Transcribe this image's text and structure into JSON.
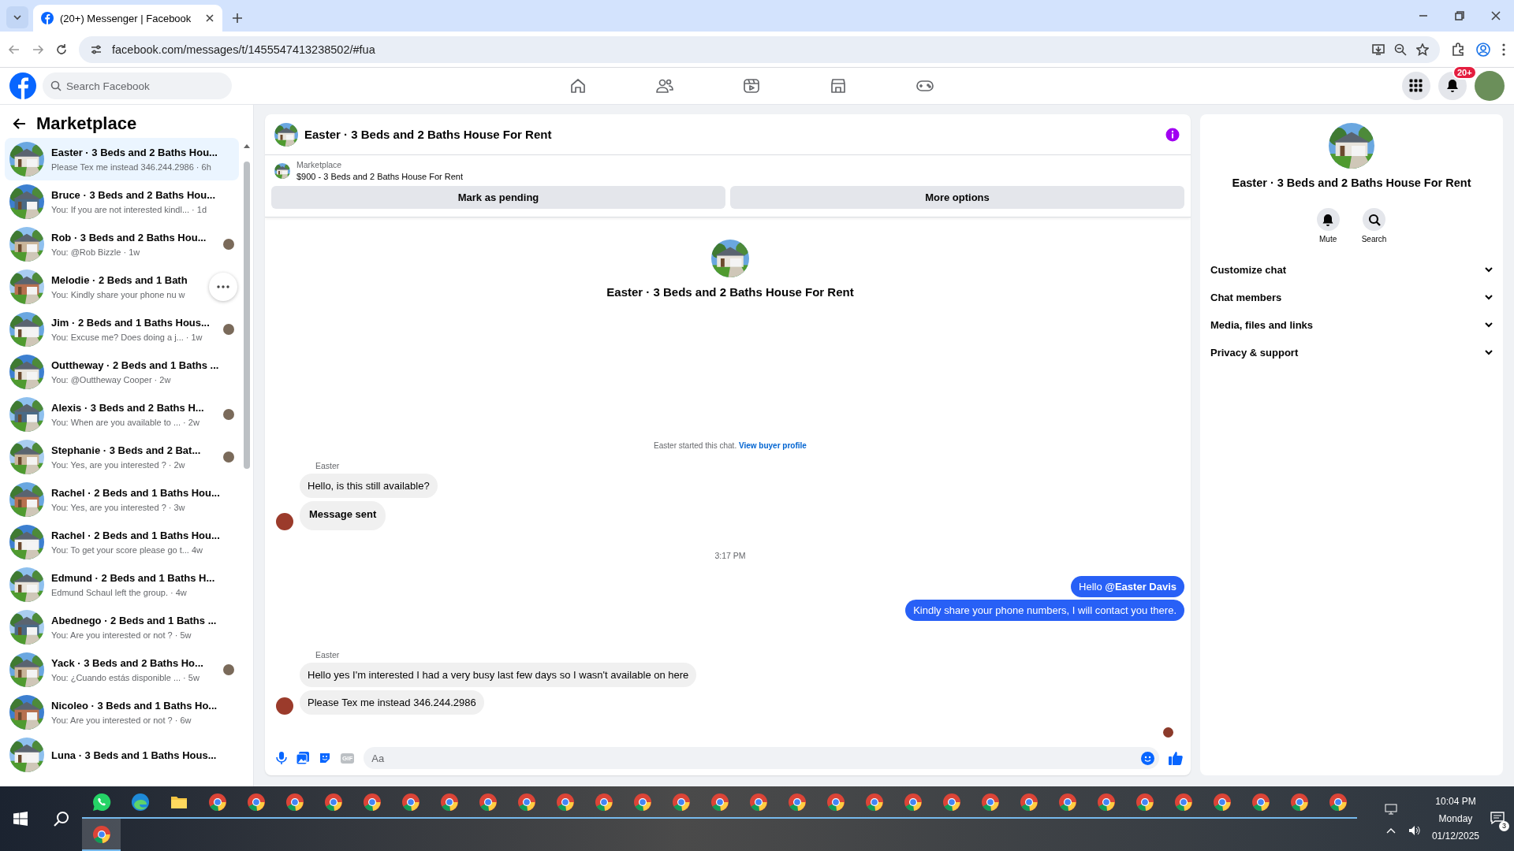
{
  "browser": {
    "tab_title": "(20+) Messenger | Facebook",
    "url": "facebook.com/messages/t/1455547413238502/#fua"
  },
  "topbar": {
    "search_placeholder": "Search Facebook",
    "nav": [
      {
        "kind": "home"
      },
      {
        "kind": "friends"
      },
      {
        "kind": "video"
      },
      {
        "kind": "marketplace"
      },
      {
        "kind": "gaming"
      }
    ],
    "notification_badge": "20+"
  },
  "sidebar": {
    "title": "Marketplace",
    "conversations": [
      {
        "name": "Easter · 3 Beds and 2 Baths Hou...",
        "preview": "Please Tex me instead 346.244.2986",
        "time": "· 6h",
        "selected": true,
        "seen": false,
        "more_button": false
      },
      {
        "name": "Bruce · 3 Beds and 2 Baths Hou...",
        "preview": "You: If you are not interested kindl...",
        "time": "· 1d",
        "selected": false,
        "seen": false,
        "more_button": false
      },
      {
        "name": "Rob · 3 Beds and 2 Baths Hou...",
        "preview": "You: @Rob Bizzle",
        "time": "· 1w",
        "selected": false,
        "seen": true,
        "more_button": false
      },
      {
        "name": "Melodie · 2 Beds and 1 Bath",
        "preview": "You: Kindly share your phone nu",
        "time": "w",
        "selected": false,
        "seen": false,
        "more_button": true
      },
      {
        "name": "Jim · 2 Beds and 1 Baths Hous...",
        "preview": "You: Excuse me? Does doing a j...",
        "time": "· 1w",
        "selected": false,
        "seen": true,
        "more_button": false
      },
      {
        "name": "Outtheway · 2 Beds and 1 Baths ...",
        "preview": "You: @Outtheway Cooper",
        "time": "· 2w",
        "selected": false,
        "seen": false,
        "more_button": false
      },
      {
        "name": "Alexis · 3 Beds and 2 Baths H...",
        "preview": "You: When are you available to ...",
        "time": "· 2w",
        "selected": false,
        "seen": true,
        "more_button": false
      },
      {
        "name": "Stephanie · 3 Beds and 2 Bat...",
        "preview": "You: Yes, are you interested ?",
        "time": "· 2w",
        "selected": false,
        "seen": true,
        "more_button": false
      },
      {
        "name": "Rachel · 2 Beds and 1 Baths Hou...",
        "preview": "You: Yes, are you interested ?",
        "time": "· 3w",
        "selected": false,
        "seen": false,
        "more_button": false
      },
      {
        "name": "Rachel · 2 Beds and 1 Baths Hou...",
        "preview": "You: To get your score please go t...",
        "time": "4w",
        "selected": false,
        "seen": false,
        "more_button": false
      },
      {
        "name": "Edmund · 2 Beds and 1 Baths H...",
        "preview": "Edmund Schaul left the group.",
        "time": "· 4w",
        "selected": false,
        "seen": false,
        "more_button": false
      },
      {
        "name": "Abednego · 2 Beds and 1 Baths ...",
        "preview": "You: Are you interested or not ?",
        "time": "· 5w",
        "selected": false,
        "seen": false,
        "more_button": false
      },
      {
        "name": "Yack · 3 Beds and 2 Baths Ho...",
        "preview": "You: ¿Cuando estás disponible ...",
        "time": "· 5w",
        "selected": false,
        "seen": true,
        "more_button": false
      },
      {
        "name": "Nicoleo · 3 Beds and 1 Baths Ho...",
        "preview": "You: Are you interested or not ?",
        "time": "· 6w",
        "selected": false,
        "seen": false,
        "more_button": false
      },
      {
        "name": "Luna · 3 Beds and 1 Baths Hous...",
        "selected": false,
        "seen": false,
        "more_button": false
      }
    ]
  },
  "chat": {
    "title": "Easter · 3 Beds and 2 Baths House For Rent",
    "listing": {
      "label": "Marketplace",
      "text": "$900 - 3 Beds and 2 Baths House For Rent"
    },
    "actions": [
      "Mark as pending",
      "More options"
    ],
    "intro_title": "Easter · 3 Beds and 2 Baths House For Rent",
    "started": {
      "text": "Easter started this chat.",
      "link": "View buyer profile"
    },
    "thread": [
      {
        "kind": "sender",
        "text": "Easter"
      },
      {
        "kind": "in",
        "text": "Hello, is this still available?",
        "bold": false,
        "avatar": false
      },
      {
        "kind": "in",
        "text": "Message sent",
        "bold": true,
        "avatar": true
      },
      {
        "kind": "time",
        "text": "3:17 PM"
      },
      {
        "kind": "out",
        "text": "Hello **@Easter Davis**"
      },
      {
        "kind": "out",
        "text": "Kindly share your phone numbers, I will contact you there."
      },
      {
        "kind": "sender",
        "text": "Easter"
      },
      {
        "kind": "in",
        "text": "Hello yes I'm interested I had a very busy last few days so I wasn't available on here",
        "bold": false,
        "avatar": false
      },
      {
        "kind": "in",
        "text": "Please Tex me instead 346.244.2986",
        "bold": false,
        "avatar": true
      },
      {
        "kind": "seen"
      }
    ],
    "composer": {
      "placeholder": "Aa",
      "gif": "GIF"
    }
  },
  "info": {
    "title": "Easter · 3 Beds and 2 Baths House For Rent",
    "actions": [
      {
        "kind": "mute",
        "label": "Mute"
      },
      {
        "kind": "search",
        "label": "Search"
      }
    ],
    "sections": [
      {
        "label": "Customize chat",
        "expanded": false
      },
      {
        "label": "Chat members",
        "expanded": false
      },
      {
        "label": "Media, files and links",
        "expanded": false
      },
      {
        "label": "Privacy & support",
        "expanded": false
      }
    ]
  },
  "taskbar": {
    "apps": [
      {
        "kind": "whatsapp"
      },
      {
        "kind": "edge"
      },
      {
        "kind": "explorer"
      },
      {
        "kind": "chrome"
      },
      {
        "kind": "chrome"
      },
      {
        "kind": "chrome"
      },
      {
        "kind": "chrome"
      },
      {
        "kind": "chrome"
      },
      {
        "kind": "chrome"
      },
      {
        "kind": "chrome"
      },
      {
        "kind": "chrome"
      },
      {
        "kind": "chrome"
      },
      {
        "kind": "chrome"
      },
      {
        "kind": "chrome"
      },
      {
        "kind": "chrome"
      },
      {
        "kind": "chrome"
      },
      {
        "kind": "chrome"
      },
      {
        "kind": "chrome"
      },
      {
        "kind": "chrome"
      },
      {
        "kind": "chrome"
      },
      {
        "kind": "chrome"
      },
      {
        "kind": "chrome"
      },
      {
        "kind": "chrome"
      },
      {
        "kind": "chrome"
      },
      {
        "kind": "chrome"
      },
      {
        "kind": "chrome"
      },
      {
        "kind": "chrome"
      },
      {
        "kind": "chrome"
      },
      {
        "kind": "chrome"
      },
      {
        "kind": "chrome"
      },
      {
        "kind": "chrome"
      },
      {
        "kind": "chrome"
      },
      {
        "kind": "chrome"
      }
    ],
    "second_row": [
      {
        "kind": "chrome"
      }
    ],
    "time": "10:04 PM",
    "day": "Monday",
    "date": "01/12/2025",
    "notifications": "3"
  }
}
